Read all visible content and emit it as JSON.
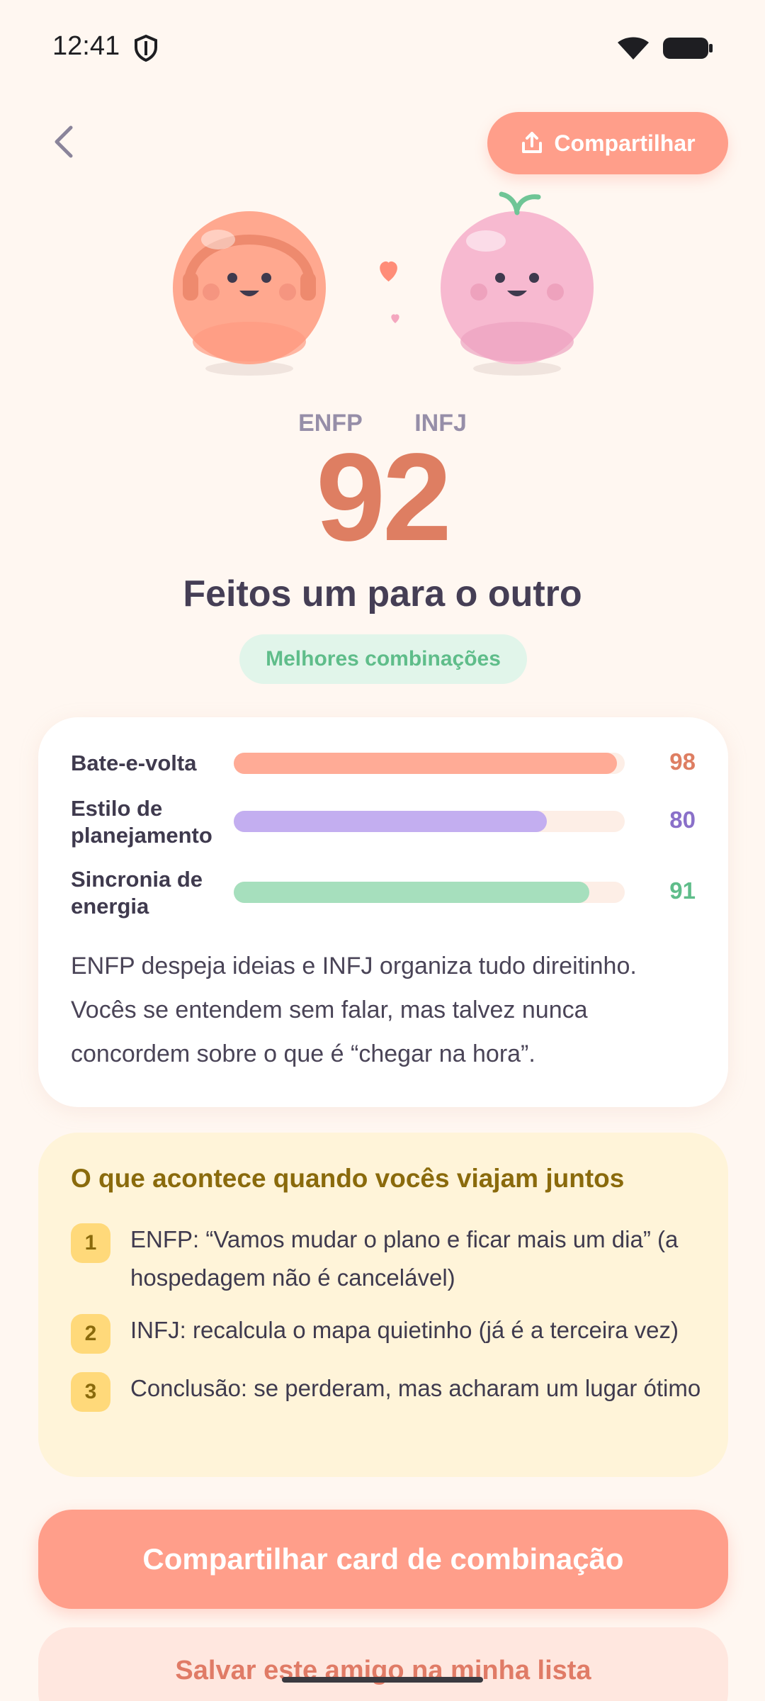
{
  "status_bar": {
    "time": "12:41"
  },
  "header": {
    "share_label": "Compartilhar"
  },
  "match": {
    "type_a": "ENFP",
    "type_b": "INFJ",
    "score": "92",
    "verdict": "Feitos um para o outro",
    "badge": "Melhores combinações"
  },
  "metrics": [
    {
      "label": "Bate-e-volta",
      "value": "98",
      "fill_percent": 98,
      "color": "#ffab96",
      "value_color": "#de7e62"
    },
    {
      "label": "Estilo de planejamento",
      "value": "80",
      "fill_percent": 80,
      "color": "#c3aef0",
      "value_color": "#8a70c9"
    },
    {
      "label": "Sincronia de energia",
      "value": "91",
      "fill_percent": 91,
      "color": "#a6dfbd",
      "value_color": "#5fbd8a"
    }
  ],
  "summary": "ENFP despeja ideias e INFJ organiza tudo direitinho. Vocês se entendem sem falar, mas talvez nunca concordem sobre o que é “chegar na hora”.",
  "trip": {
    "title": "O que acontece quando vocês viajam juntos",
    "items": [
      {
        "number": "1",
        "text": "ENFP: “Vamos mudar o plano e ficar mais um dia” (a hospedagem não é cancelável)"
      },
      {
        "number": "2",
        "text": "INFJ: recalcula o mapa quietinho (já é a terceira vez)"
      },
      {
        "number": "3",
        "text": "Conclusão: se perderam, mas acharam um lugar ótimo"
      }
    ]
  },
  "actions": {
    "primary_label": "Compartilhar card de combinação",
    "secondary_label": "Salvar este amigo na minha lista"
  },
  "icons": [
    "shield-icon",
    "wifi-icon",
    "battery-icon",
    "back-chevron-icon",
    "share-upload-icon",
    "heart-icon"
  ]
}
